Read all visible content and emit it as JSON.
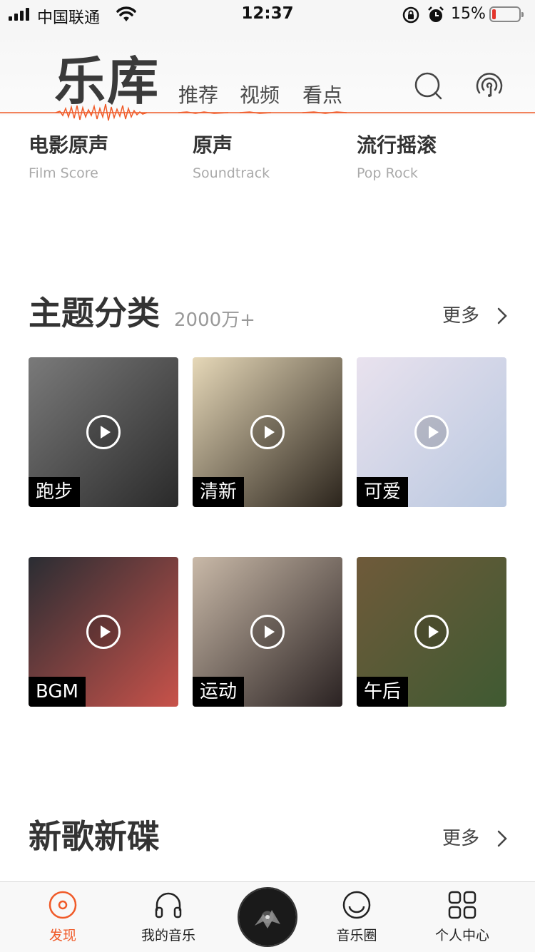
{
  "status_bar": {
    "carrier": "中国联通",
    "time": "12:37",
    "battery_percent": "15%",
    "battery_level": 0.15,
    "icons": [
      "signal-icon",
      "wifi-icon",
      "rotation-lock-icon",
      "alarm-icon",
      "battery-icon"
    ]
  },
  "header": {
    "title": "乐库",
    "tabs": [
      {
        "label": "推荐"
      },
      {
        "label": "视频"
      },
      {
        "label": "看点"
      }
    ],
    "accent_color": "#f05a28",
    "icons": [
      "search-icon",
      "listen-recognize-icon"
    ]
  },
  "genres": [
    {
      "cn": "电影原声",
      "en": "Film Score"
    },
    {
      "cn": "原声",
      "en": "Soundtrack"
    },
    {
      "cn": "流行摇滚",
      "en": "Pop Rock"
    }
  ],
  "theme_section": {
    "title": "主题分类",
    "count": "2000万+",
    "more": "更多",
    "tiles": [
      {
        "label": "跑步",
        "colors": [
          "#7a7a7a",
          "#2a2a2a"
        ]
      },
      {
        "label": "清新",
        "colors": [
          "#e6d8b8",
          "#2b241c"
        ]
      },
      {
        "label": "可爱",
        "colors": [
          "#e9e2ee",
          "#b9c8e0"
        ]
      },
      {
        "label": "BGM",
        "colors": [
          "#2a2d33",
          "#c8524a"
        ]
      },
      {
        "label": "运动",
        "colors": [
          "#c9b9a8",
          "#2a2222"
        ]
      },
      {
        "label": "午后",
        "colors": [
          "#6f5a3a",
          "#3f5a32"
        ]
      }
    ]
  },
  "new_section": {
    "title": "新歌新碟",
    "more": "更多"
  },
  "tabbar": {
    "items": [
      {
        "label": "发现",
        "icon": "discover-icon",
        "active": true
      },
      {
        "label": "我的音乐",
        "icon": "headphones-icon",
        "active": false
      },
      {
        "label": "",
        "icon": "now-playing-disc",
        "active": false
      },
      {
        "label": "音乐圈",
        "icon": "music-circle-icon",
        "active": false
      },
      {
        "label": "个人中心",
        "icon": "grid-icon",
        "active": false
      }
    ]
  }
}
